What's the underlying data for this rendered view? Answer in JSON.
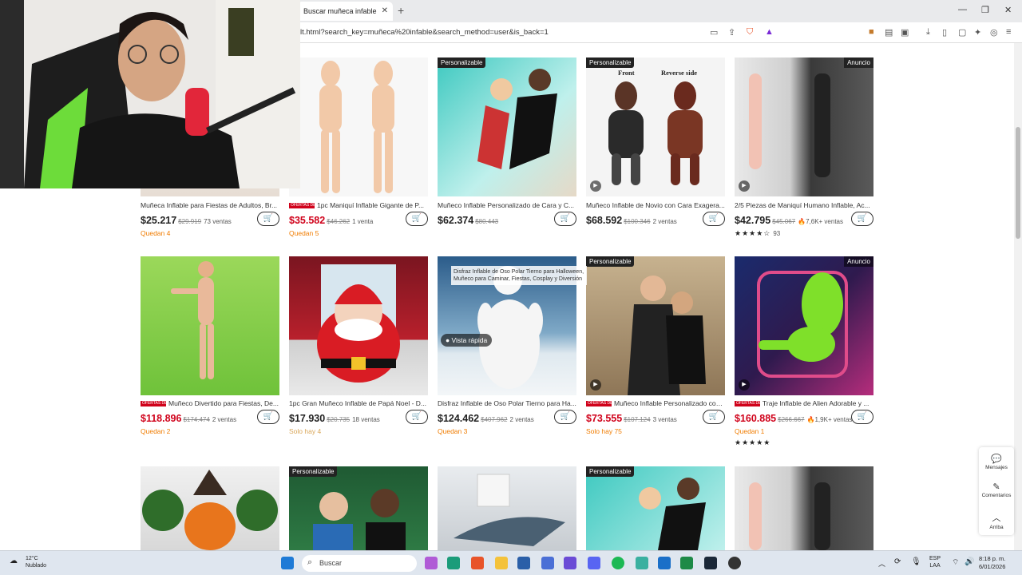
{
  "browser": {
    "tab_title": "Buscar muñeca infable",
    "url": "lt.html?search_key=muñeca%20infable&search_method=user&is_back=1"
  },
  "labels": {
    "personalizable": "Personalizable",
    "anuncio": "Anuncio",
    "ofertas": "OFERTAS DE 2026",
    "vista_rapida": "Vista rápida"
  },
  "products": [
    {
      "title": "Muñeca Inflable para Fiestas de Adultos, Br...",
      "price": "$25.217",
      "old": "$29.919",
      "sales": "73 ventas",
      "stock": "Quedan 4"
    },
    {
      "title": "1pc Maniquí Inflable Gigante de P...",
      "price": "$35.582",
      "old": "$46.262",
      "sales": "1 venta",
      "stock": "Quedan 5"
    },
    {
      "title": "Muñeco Inflable Personalizado de Cara y C...",
      "price": "$62.374",
      "old": "$80.443",
      "sales": "",
      "stock": ""
    },
    {
      "title": "Muñeco Inflable de Novio con Cara Exagera...",
      "price": "$68.592",
      "old": "$100.346",
      "sales": "2 ventas",
      "stock": ""
    },
    {
      "title": "2/5 Piezas de Maniquí Humano Inflable, Ac...",
      "price": "$42.795",
      "old": "$45.067",
      "sales": "7,6K+ ventas",
      "stars": "★★★★☆",
      "rating_count": "93"
    },
    {
      "title": "Muñeco Divertido para Fiestas, De...",
      "price": "$118.896",
      "old": "$174.474",
      "sales": "2 ventas",
      "stock": "Quedan 2"
    },
    {
      "title": "1pc Gran Muñeco Inflable de Papá Noel - D...",
      "price": "$17.930",
      "old": "$20.735",
      "sales": "18 ventas",
      "stock": "Solo hay 4"
    },
    {
      "title": "Disfraz Inflable de Oso Polar Tierno para Ha...",
      "price": "$124.462",
      "old": "$407.962",
      "sales": "2 ventas",
      "stock": "Quedan 3"
    },
    {
      "title": "Muñeco Inflable Personalizado con...",
      "price": "$73.555",
      "old": "$107.124",
      "sales": "3 ventas",
      "stock": "Solo hay 75"
    },
    {
      "title": "Traje Inflable de Alien Adorable y ...",
      "price": "$160.885",
      "old": "$266.667",
      "sales": "1,9K+ ventas",
      "stock": "Quedan 1",
      "stars": "★★★★★"
    }
  ],
  "front_back": {
    "front": "Front",
    "back": "Reverse side"
  },
  "tooltip": "Disfraz Inflable de Oso Polar Tierno para Halloween, Muñeco para Caminar, Fiestas, Cosplay y Diversión",
  "side_panel": {
    "messages": "Mensajes",
    "comments": "Comentarios",
    "top": "Arriba"
  },
  "taskbar": {
    "temp": "12°C",
    "weather": "Nublado",
    "search": "Buscar",
    "lang1": "ESP",
    "lang2": "LAA",
    "time": "8:18 p. m.",
    "date": "6/01/2026"
  }
}
